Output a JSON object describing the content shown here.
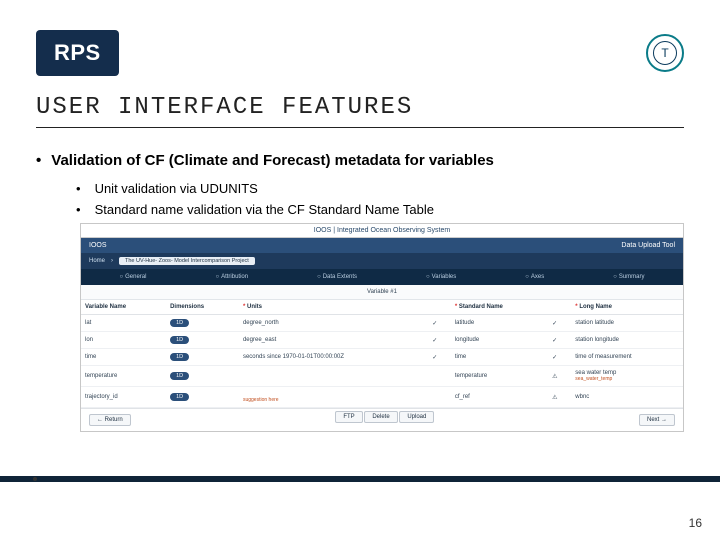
{
  "header": {
    "logo": "RPS",
    "icon_glyph": "T"
  },
  "title": "USER INTERFACE FEATURES",
  "bullets": {
    "main": "Validation of CF (Climate and Forecast) metadata for variables",
    "sub": [
      "Unit validation via UDUNITS",
      "Standard name validation via the CF Standard Name Table"
    ]
  },
  "ioos": {
    "brand": "IOOS | Integrated Ocean Observing System",
    "bar_left": "IOOS",
    "bar_right": "Data Upload Tool",
    "home": "Home",
    "crumb": "The UV-Hue- Zoos- Model Intercomparison Project",
    "steps": [
      "General",
      "Attribution",
      "Data Extents",
      "Variables",
      "Axes",
      "Summary"
    ],
    "tab": "Variable #1",
    "columns": [
      "Variable Name",
      "Dimensions",
      "Units",
      "Standard Name",
      "Long Name"
    ],
    "rows": [
      {
        "name": "lat",
        "dim": "1D",
        "units": "degree_north",
        "uok": "✓",
        "std": "latitude",
        "sok": "✓",
        "long": "station latitude"
      },
      {
        "name": "lon",
        "dim": "1D",
        "units": "degree_east",
        "uok": "✓",
        "std": "longitude",
        "sok": "✓",
        "long": "station longitude"
      },
      {
        "name": "time",
        "dim": "1D",
        "units": "seconds since 1970-01-01T00:00:00Z",
        "uok": "✓",
        "std": "time",
        "sok": "✓",
        "long": "time of measurement"
      },
      {
        "name": "temperature",
        "dim": "1D",
        "units": "",
        "uok": "",
        "std": "temperature",
        "sok": "⚠",
        "long": "sea water temp",
        "suggest": "sea_water_temp"
      },
      {
        "name": "trajectory_id",
        "dim": "1D",
        "units": "",
        "uok": "",
        "std": "cf_ref",
        "sok": "⚠",
        "long": "wbnc",
        "suggest": "suggestion here"
      }
    ],
    "footer": {
      "back": "← Return",
      "mid1": "FTP",
      "mid2": "Delete",
      "mid3": "Upload",
      "next": "Next →"
    }
  },
  "page_number": "16"
}
